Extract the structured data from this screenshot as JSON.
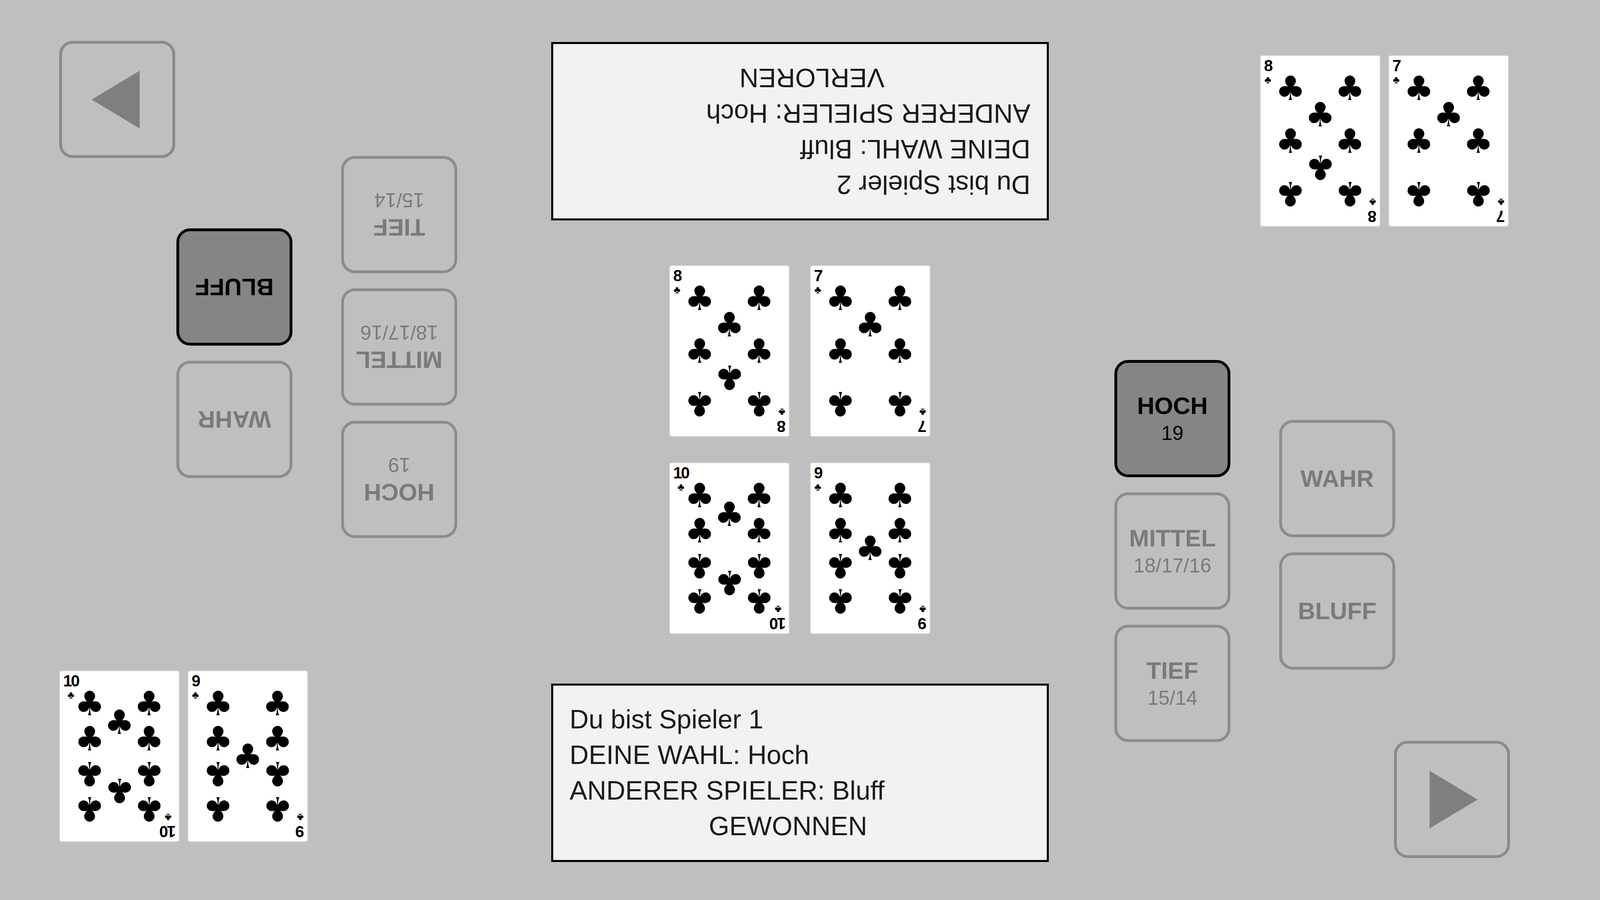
{
  "player1": {
    "message": {
      "lines": [
        "Du bist Spieler 1",
        "DEINE WAHL: Hoch",
        "ANDERER SPIELER: Bluff"
      ],
      "result": "GEWONNEN"
    },
    "hand": [
      {
        "rank": "10",
        "suit": "♣"
      },
      {
        "rank": "9",
        "suit": "♣"
      }
    ],
    "range_buttons": [
      {
        "label": "HOCH",
        "values": "19",
        "selected": true
      },
      {
        "label": "MITTEL",
        "values": "18/17/16",
        "selected": false
      },
      {
        "label": "TIEF",
        "values": "15/14",
        "selected": false
      }
    ],
    "claim_buttons": [
      {
        "label": "WAHR",
        "selected": false
      },
      {
        "label": "BLUFF",
        "selected": false
      }
    ]
  },
  "player2": {
    "message": {
      "lines": [
        "Du bist Spieler 2",
        "DEINE WAHL: Bluff",
        "ANDERER SPIELER: Hoch"
      ],
      "result": "VERLOREN"
    },
    "hand": [
      {
        "rank": "8",
        "suit": "♣"
      },
      {
        "rank": "7",
        "suit": "♣"
      }
    ],
    "range_buttons": [
      {
        "label": "HOCH",
        "values": "19",
        "selected": false
      },
      {
        "label": "MITTEL",
        "values": "18/17/16",
        "selected": false
      },
      {
        "label": "TIEF",
        "values": "15/14",
        "selected": false
      }
    ],
    "claim_buttons": [
      {
        "label": "WAHR",
        "selected": false
      },
      {
        "label": "BLUFF",
        "selected": true
      }
    ]
  },
  "table_cards": [
    {
      "rank": "8",
      "suit": "♣"
    },
    {
      "rank": "7",
      "suit": "♣"
    },
    {
      "rank": "10",
      "suit": "♣"
    },
    {
      "rank": "9",
      "suit": "♣"
    }
  ]
}
